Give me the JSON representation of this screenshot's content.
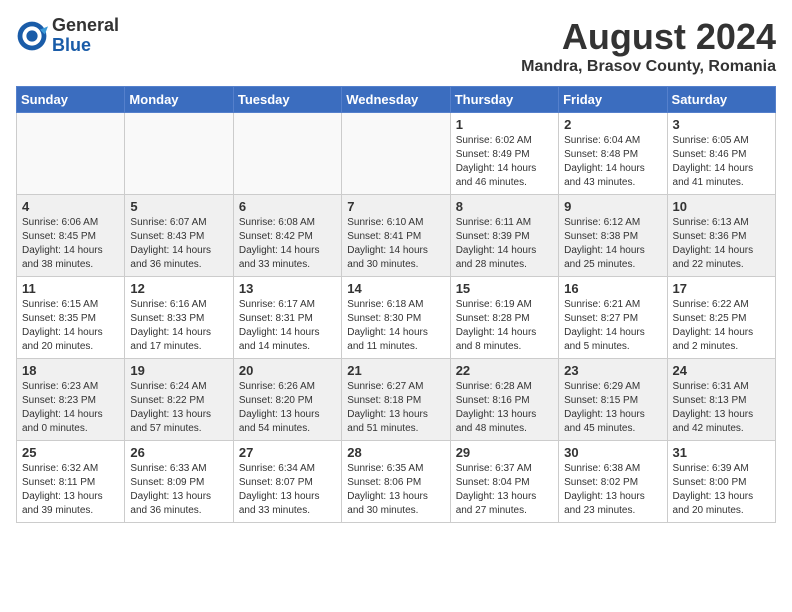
{
  "logo": {
    "general": "General",
    "blue": "Blue"
  },
  "title": {
    "month_year": "August 2024",
    "location": "Mandra, Brasov County, Romania"
  },
  "days_of_week": [
    "Sunday",
    "Monday",
    "Tuesday",
    "Wednesday",
    "Thursday",
    "Friday",
    "Saturday"
  ],
  "weeks": [
    [
      {
        "day": "",
        "info": ""
      },
      {
        "day": "",
        "info": ""
      },
      {
        "day": "",
        "info": ""
      },
      {
        "day": "",
        "info": ""
      },
      {
        "day": "1",
        "info": "Sunrise: 6:02 AM\nSunset: 8:49 PM\nDaylight: 14 hours and 46 minutes."
      },
      {
        "day": "2",
        "info": "Sunrise: 6:04 AM\nSunset: 8:48 PM\nDaylight: 14 hours and 43 minutes."
      },
      {
        "day": "3",
        "info": "Sunrise: 6:05 AM\nSunset: 8:46 PM\nDaylight: 14 hours and 41 minutes."
      }
    ],
    [
      {
        "day": "4",
        "info": "Sunrise: 6:06 AM\nSunset: 8:45 PM\nDaylight: 14 hours and 38 minutes."
      },
      {
        "day": "5",
        "info": "Sunrise: 6:07 AM\nSunset: 8:43 PM\nDaylight: 14 hours and 36 minutes."
      },
      {
        "day": "6",
        "info": "Sunrise: 6:08 AM\nSunset: 8:42 PM\nDaylight: 14 hours and 33 minutes."
      },
      {
        "day": "7",
        "info": "Sunrise: 6:10 AM\nSunset: 8:41 PM\nDaylight: 14 hours and 30 minutes."
      },
      {
        "day": "8",
        "info": "Sunrise: 6:11 AM\nSunset: 8:39 PM\nDaylight: 14 hours and 28 minutes."
      },
      {
        "day": "9",
        "info": "Sunrise: 6:12 AM\nSunset: 8:38 PM\nDaylight: 14 hours and 25 minutes."
      },
      {
        "day": "10",
        "info": "Sunrise: 6:13 AM\nSunset: 8:36 PM\nDaylight: 14 hours and 22 minutes."
      }
    ],
    [
      {
        "day": "11",
        "info": "Sunrise: 6:15 AM\nSunset: 8:35 PM\nDaylight: 14 hours and 20 minutes."
      },
      {
        "day": "12",
        "info": "Sunrise: 6:16 AM\nSunset: 8:33 PM\nDaylight: 14 hours and 17 minutes."
      },
      {
        "day": "13",
        "info": "Sunrise: 6:17 AM\nSunset: 8:31 PM\nDaylight: 14 hours and 14 minutes."
      },
      {
        "day": "14",
        "info": "Sunrise: 6:18 AM\nSunset: 8:30 PM\nDaylight: 14 hours and 11 minutes."
      },
      {
        "day": "15",
        "info": "Sunrise: 6:19 AM\nSunset: 8:28 PM\nDaylight: 14 hours and 8 minutes."
      },
      {
        "day": "16",
        "info": "Sunrise: 6:21 AM\nSunset: 8:27 PM\nDaylight: 14 hours and 5 minutes."
      },
      {
        "day": "17",
        "info": "Sunrise: 6:22 AM\nSunset: 8:25 PM\nDaylight: 14 hours and 2 minutes."
      }
    ],
    [
      {
        "day": "18",
        "info": "Sunrise: 6:23 AM\nSunset: 8:23 PM\nDaylight: 14 hours and 0 minutes."
      },
      {
        "day": "19",
        "info": "Sunrise: 6:24 AM\nSunset: 8:22 PM\nDaylight: 13 hours and 57 minutes."
      },
      {
        "day": "20",
        "info": "Sunrise: 6:26 AM\nSunset: 8:20 PM\nDaylight: 13 hours and 54 minutes."
      },
      {
        "day": "21",
        "info": "Sunrise: 6:27 AM\nSunset: 8:18 PM\nDaylight: 13 hours and 51 minutes."
      },
      {
        "day": "22",
        "info": "Sunrise: 6:28 AM\nSunset: 8:16 PM\nDaylight: 13 hours and 48 minutes."
      },
      {
        "day": "23",
        "info": "Sunrise: 6:29 AM\nSunset: 8:15 PM\nDaylight: 13 hours and 45 minutes."
      },
      {
        "day": "24",
        "info": "Sunrise: 6:31 AM\nSunset: 8:13 PM\nDaylight: 13 hours and 42 minutes."
      }
    ],
    [
      {
        "day": "25",
        "info": "Sunrise: 6:32 AM\nSunset: 8:11 PM\nDaylight: 13 hours and 39 minutes."
      },
      {
        "day": "26",
        "info": "Sunrise: 6:33 AM\nSunset: 8:09 PM\nDaylight: 13 hours and 36 minutes."
      },
      {
        "day": "27",
        "info": "Sunrise: 6:34 AM\nSunset: 8:07 PM\nDaylight: 13 hours and 33 minutes."
      },
      {
        "day": "28",
        "info": "Sunrise: 6:35 AM\nSunset: 8:06 PM\nDaylight: 13 hours and 30 minutes."
      },
      {
        "day": "29",
        "info": "Sunrise: 6:37 AM\nSunset: 8:04 PM\nDaylight: 13 hours and 27 minutes."
      },
      {
        "day": "30",
        "info": "Sunrise: 6:38 AM\nSunset: 8:02 PM\nDaylight: 13 hours and 23 minutes."
      },
      {
        "day": "31",
        "info": "Sunrise: 6:39 AM\nSunset: 8:00 PM\nDaylight: 13 hours and 20 minutes."
      }
    ]
  ]
}
